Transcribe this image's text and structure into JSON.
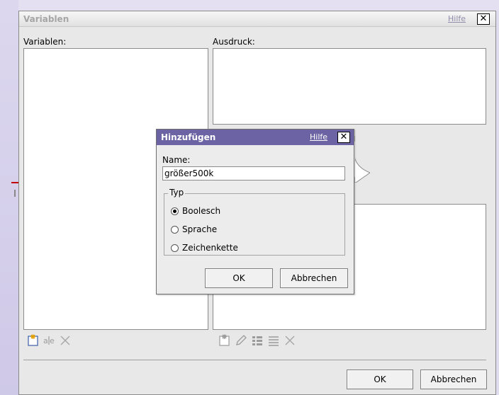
{
  "main_dialog": {
    "title": "Variablen",
    "help_label": "Hilfe",
    "close_glyph": "✕",
    "variables_label": "Variablen:",
    "expression_label": "Ausdruck:",
    "ok_label": "OK",
    "cancel_label": "Abbrechen"
  },
  "sub_dialog": {
    "title": "Hinzufügen",
    "help_label": "Hilfe",
    "close_glyph": "✕",
    "name_label": "Name:",
    "name_value": "größer500k",
    "type_legend": "Typ",
    "options": [
      {
        "label": "Boolesch",
        "checked": true
      },
      {
        "label": "Sprache",
        "checked": false
      },
      {
        "label": "Zeichenkette",
        "checked": false
      }
    ],
    "ok_label": "OK",
    "cancel_label": "Abbrechen"
  },
  "left_toolbar": {
    "add_icon": "new-variable-icon",
    "rename_icon": "rename-icon",
    "delete_icon": "delete-icon"
  },
  "right_toolbar": {
    "add_icon": "new-expression-icon",
    "edit_icon": "pencil-icon",
    "list_icon": "list-icon",
    "align_icon": "align-icon",
    "delete_icon": "delete-icon"
  },
  "colors": {
    "sub_title_bar": "#6b63a3",
    "background": "#e0dcef"
  }
}
